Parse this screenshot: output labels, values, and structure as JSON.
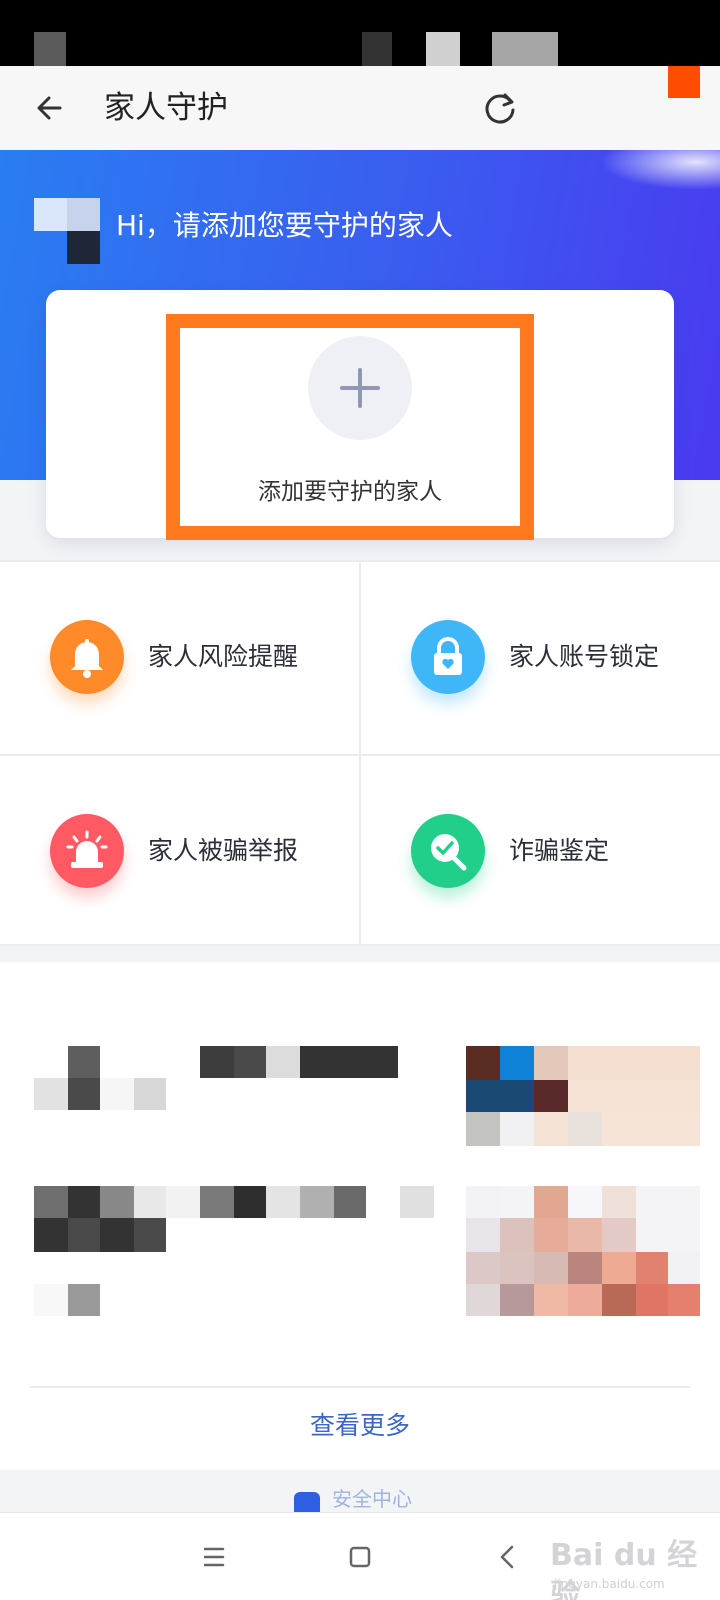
{
  "header": {
    "title": "家人守护"
  },
  "hero": {
    "greeting": "Hi，请添加您要守护的家人"
  },
  "add_card": {
    "label": "添加要守护的家人"
  },
  "features": [
    {
      "label": "家人风险提醒",
      "icon": "bell-icon",
      "color": "#ff8a2a"
    },
    {
      "label": "家人账号锁定",
      "icon": "lock-icon",
      "color": "#3fb6f7"
    },
    {
      "label": "家人被骗举报",
      "icon": "alarm-icon",
      "color": "#ff5a64"
    },
    {
      "label": "诈骗鉴定",
      "icon": "magnifier-check-icon",
      "color": "#22cf8a"
    }
  ],
  "articles": {
    "see_more_label": "查看更多"
  },
  "footer": {
    "text": "安全中心"
  },
  "watermark": {
    "brand": "Bai du 经验",
    "sub": "jingyan.baidu.com"
  },
  "colors": {
    "accent": "#3a66c8",
    "highlight_box": "#ff7a1f",
    "hero_start": "#2a7df2",
    "hero_end": "#4a3af0"
  }
}
